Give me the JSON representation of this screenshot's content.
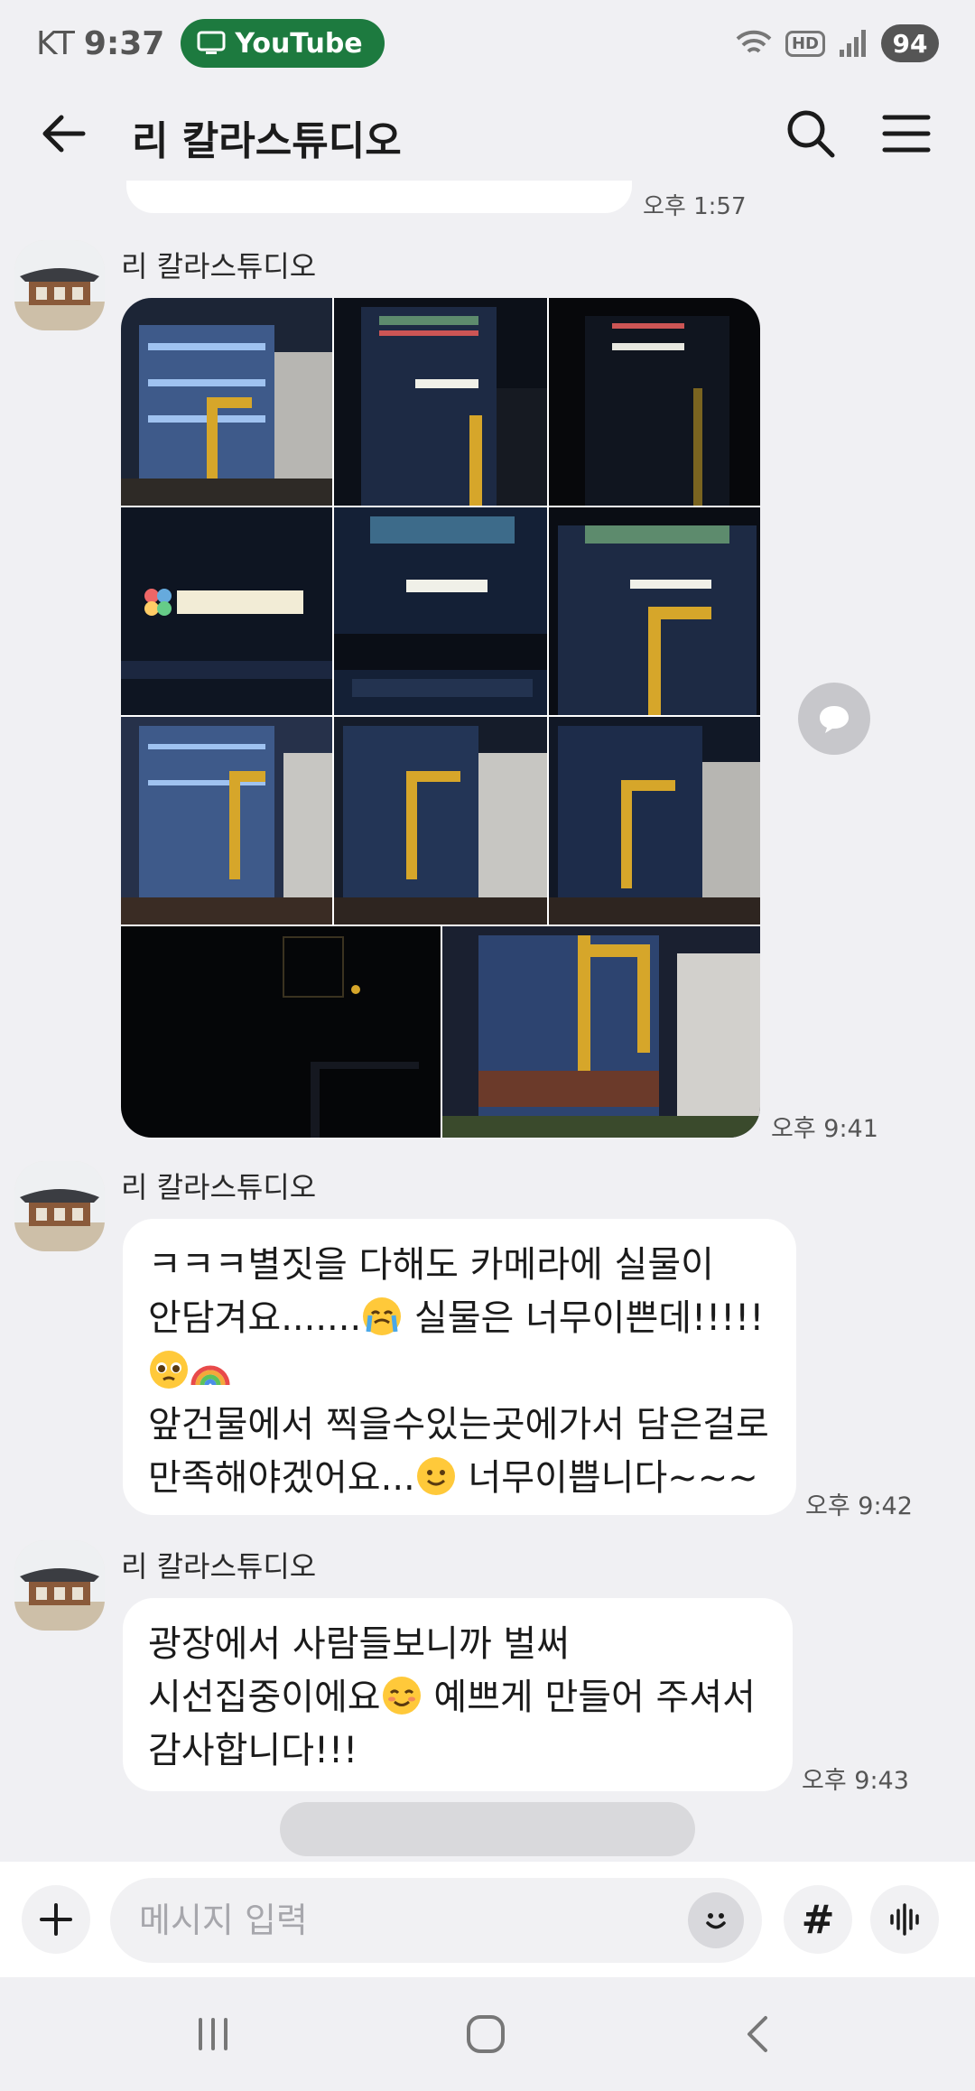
{
  "status_bar": {
    "carrier": "KT",
    "time": "9:37",
    "active_app": "YouTube",
    "hd_label": "HD",
    "battery": "94"
  },
  "header": {
    "title": "리 칼라스튜디오"
  },
  "previous_message": {
    "time": "오후 1:57"
  },
  "messages": [
    {
      "sender": "리 칼라스튜디오",
      "kind": "photos",
      "time": "오후 9:41",
      "photo_count": 11
    },
    {
      "sender": "리 칼라스튜디오",
      "kind": "text",
      "lines": [
        "ㅋㅋㅋ별짓을 다해도 카메라에 실물이",
        "안담겨요.......",
        " 실물은 너무이쁜데!!!!!",
        "앞건물에서 찍을수있는곳에가서 담은걸로",
        "만족해야겠어요...",
        " 너무이쁩니다~~~"
      ],
      "time": "오후 9:42"
    },
    {
      "sender": "리 칼라스튜디오",
      "kind": "text",
      "lines": [
        "광장에서 사람들보니까 벌써",
        "시선집중이에요",
        " 예쁘게 만들어 주셔서",
        "감사합니다!!!"
      ],
      "time": "오후 9:43"
    }
  ],
  "input": {
    "placeholder": "메시지 입력",
    "hash_label": "#"
  },
  "colors": {
    "background": "#f0f0f3",
    "bubble": "#ffffff",
    "status_pill": "#1d7a3f"
  },
  "icons": [
    "back-arrow-icon",
    "search-icon",
    "hamburger-menu-icon",
    "share-icon",
    "plus-icon",
    "emoji-icon",
    "hashtag-icon",
    "voice-icon",
    "recents-icon",
    "home-icon",
    "nav-back-icon"
  ]
}
